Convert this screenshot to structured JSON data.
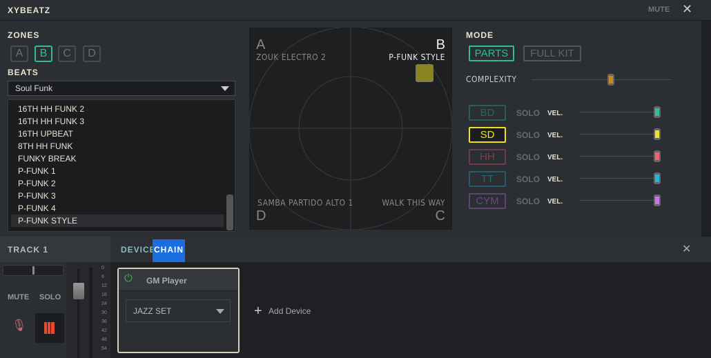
{
  "app": {
    "title": "XYBEATZ",
    "mute_label": "MUTE",
    "close_icon": "close-icon"
  },
  "zones": {
    "title": "ZONES",
    "items": [
      "A",
      "B",
      "C",
      "D"
    ],
    "selected": "B"
  },
  "beats": {
    "title": "BEATS",
    "selected": "Soul Funk",
    "items": [
      "16TH HH FUNK 2",
      "16TH HH FUNK 3",
      "16TH UPBEAT",
      "8TH HH FUNK",
      "FUNKY BREAK",
      "P-FUNK 1",
      "P-FUNK 2",
      "P-FUNK 3",
      "P-FUNK 4",
      "P-FUNK STYLE"
    ],
    "selected_item": "P-FUNK STYLE"
  },
  "pad": {
    "corners": {
      "a": {
        "letter": "A",
        "beat": "ZOUK ELECTRO 2"
      },
      "b": {
        "letter": "B",
        "beat": "P-FUNK STYLE"
      },
      "c": {
        "letter": "C",
        "beat": "WALK THIS WAY"
      },
      "d": {
        "letter": "D",
        "beat": "SAMBA PARTIDO ALTO 1"
      }
    },
    "puck_color": "#8a8420"
  },
  "mode": {
    "title": "MODE",
    "options": [
      "PARTS",
      "FULL KIT"
    ],
    "selected": "PARTS",
    "complexity_label": "COMPLEXITY",
    "complexity": 0.57
  },
  "parts": [
    {
      "name": "BD",
      "solo": "SOLO",
      "vel": "VEL.",
      "velocity": 1.0,
      "color": "#2fbf9f",
      "selected": false
    },
    {
      "name": "SD",
      "solo": "SOLO",
      "vel": "VEL.",
      "velocity": 1.0,
      "color": "#f0e020",
      "selected": true
    },
    {
      "name": "HH",
      "solo": "SOLO",
      "vel": "VEL.",
      "velocity": 1.0,
      "color": "#f06070",
      "selected": false
    },
    {
      "name": "TT",
      "solo": "SOLO",
      "vel": "VEL.",
      "velocity": 1.0,
      "color": "#20b8e0",
      "selected": false
    },
    {
      "name": "CYM",
      "solo": "SOLO",
      "vel": "VEL.",
      "velocity": 1.0,
      "color": "#d070f0",
      "selected": false
    }
  ],
  "track": {
    "title": "TRACK 1",
    "mute": "MUTE",
    "solo": "SOLO",
    "fader_ticks": [
      "0",
      "6",
      "12",
      "18",
      "24",
      "30",
      "36",
      "42",
      "48",
      "54"
    ]
  },
  "chain": {
    "title_a": "DEVICE",
    "title_b": "CHAIN",
    "device": {
      "name": "GM Player",
      "preset": "JAZZ SET"
    },
    "add_device": "Add Device"
  }
}
